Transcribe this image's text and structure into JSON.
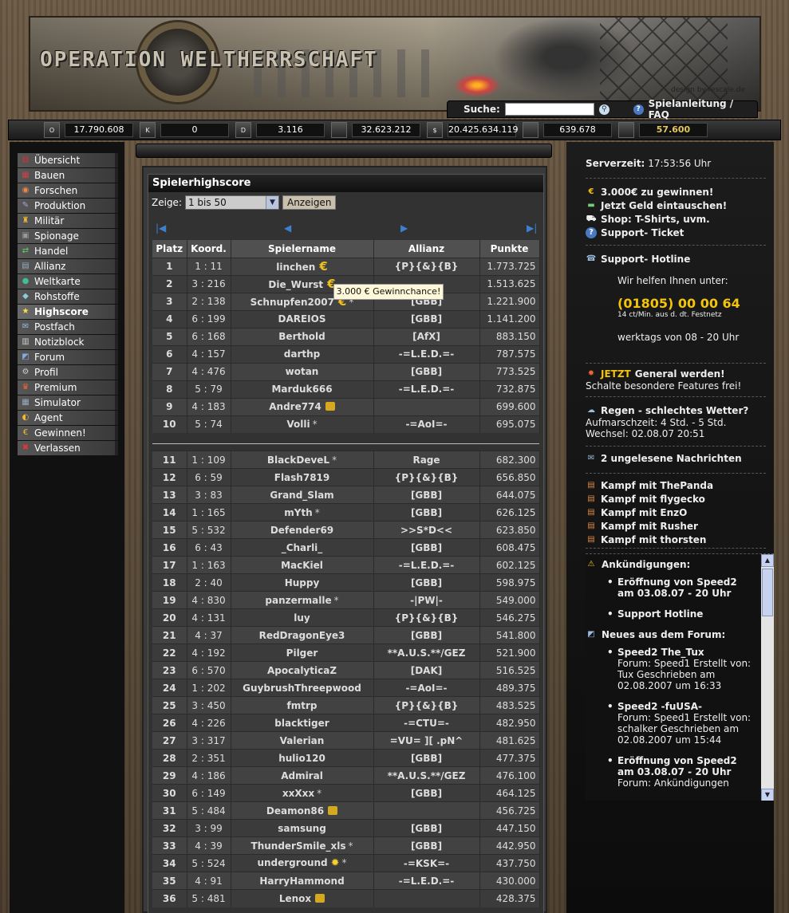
{
  "banner": {
    "logo_text": "OPERATION WELTHERRSCHAFT",
    "credit": "design by rescale.de"
  },
  "search": {
    "label": "Suche:",
    "value": "",
    "help_link": "Spielanleitung / FAQ"
  },
  "resources": [
    {
      "icon": "ore-icon",
      "badge": "O",
      "value": "17.790.608"
    },
    {
      "icon": "crystal-icon",
      "badge": "K",
      "value": "0"
    },
    {
      "icon": "deuterium-icon",
      "badge": "D",
      "value": "3.116"
    },
    {
      "icon": "ammo-icon",
      "badge": "",
      "value": "32.623.212"
    },
    {
      "icon": "money-icon",
      "badge": "$",
      "value": "20.425.634.119"
    },
    {
      "icon": "gold-bar-icon",
      "badge": "",
      "value": "639.678"
    },
    {
      "icon": "rank-icon",
      "badge": "",
      "value": "57.600"
    }
  ],
  "nav": [
    {
      "label": "Übersicht",
      "icon": "overview-icon",
      "glyph": "▤",
      "color": "#c33"
    },
    {
      "label": "Bauen",
      "icon": "build-icon",
      "glyph": "▦",
      "color": "#c44"
    },
    {
      "label": "Forschen",
      "icon": "research-icon",
      "glyph": "◉",
      "color": "#e84"
    },
    {
      "label": "Produktion",
      "icon": "production-icon",
      "glyph": "✎",
      "color": "#9ad"
    },
    {
      "label": "Militär",
      "icon": "military-icon",
      "glyph": "♜",
      "color": "#eb3"
    },
    {
      "label": "Spionage",
      "icon": "spy-icon",
      "glyph": "▣",
      "color": "#999"
    },
    {
      "label": "Handel",
      "icon": "trade-icon",
      "glyph": "⇄",
      "color": "#6c6"
    },
    {
      "label": "Allianz",
      "icon": "alliance-icon",
      "glyph": "▤",
      "color": "#9ab"
    },
    {
      "label": "Weltkarte",
      "icon": "globe-icon",
      "glyph": "●",
      "color": "#4b9"
    },
    {
      "label": "Rohstoffe",
      "icon": "resources-icon",
      "glyph": "◆",
      "color": "#8cd"
    },
    {
      "label": "Highscore",
      "icon": "highscore-icon",
      "glyph": "★",
      "color": "#fd4",
      "active": true
    },
    {
      "label": "Postfach",
      "icon": "mail-icon",
      "glyph": "✉",
      "color": "#9bd"
    },
    {
      "label": "Notizblock",
      "icon": "notepad-icon",
      "glyph": "▥",
      "color": "#ccc"
    },
    {
      "label": "Forum",
      "icon": "forum-icon",
      "glyph": "◩",
      "color": "#8ad"
    },
    {
      "label": "Profil",
      "icon": "profile-gear-icon",
      "glyph": "⚙",
      "color": "#ccc"
    },
    {
      "label": "Premium",
      "icon": "premium-icon",
      "glyph": "♛",
      "color": "#e63"
    },
    {
      "label": "Simulator",
      "icon": "simulator-icon",
      "glyph": "▦",
      "color": "#9ab"
    },
    {
      "label": "Agent",
      "icon": "agent-icon",
      "glyph": "◐",
      "color": "#eb3"
    },
    {
      "label": "Gewinnen!",
      "icon": "euro-icon",
      "glyph": "€",
      "color": "#eb3"
    },
    {
      "label": "Verlassen",
      "icon": "exit-icon",
      "glyph": "✖",
      "color": "#e33"
    }
  ],
  "highscore": {
    "title": "Spielerhighscore",
    "show_label": "Zeige:",
    "select_value": "1 bis 50",
    "submit_label": "Anzeigen",
    "columns": [
      "Platz",
      "Koord.",
      "Spielername",
      "Allianz",
      "Punkte"
    ],
    "tooltip": "3.000 € Gewinnchance!",
    "top_rows": [
      {
        "rank": "1",
        "koord": "1 : 11",
        "name": "linchen",
        "badge": "euro",
        "ally": "{P}{&}{B}",
        "points": "1.773.725"
      },
      {
        "rank": "2",
        "koord": "3 : 216",
        "name": "Die_Wurst",
        "badge": "euro",
        "ally": "",
        "points": "1.513.625"
      },
      {
        "rank": "3",
        "koord": "2 : 138",
        "name": "Schnupfen2007",
        "badge": "euro-star",
        "ally": "[GBB]",
        "points": "1.221.900"
      },
      {
        "rank": "4",
        "koord": "6 : 199",
        "name": "DAREIOS",
        "badge": "",
        "ally": "[GBB]",
        "points": "1.141.200"
      },
      {
        "rank": "5",
        "koord": "6 : 168",
        "name": "Berthold",
        "badge": "",
        "ally": "[AfX]",
        "points": "883.150"
      },
      {
        "rank": "6",
        "koord": "4 : 157",
        "name": "darthp",
        "badge": "",
        "ally": "-=L.E.D.=-",
        "points": "787.575"
      },
      {
        "rank": "7",
        "koord": "4 : 476",
        "name": "wotan",
        "badge": "",
        "ally": "[GBB]",
        "points": "773.525"
      },
      {
        "rank": "8",
        "koord": "5 : 79",
        "name": "Marduk666",
        "badge": "",
        "ally": "-=L.E.D.=-",
        "points": "732.875"
      },
      {
        "rank": "9",
        "koord": "4 : 183",
        "name": "Andre774",
        "badge": "lock",
        "ally": "",
        "points": "699.600"
      },
      {
        "rank": "10",
        "koord": "5 : 74",
        "name": "Volli",
        "badge": "star",
        "ally": "-=AoI=-",
        "points": "695.075"
      }
    ],
    "rows": [
      {
        "rank": "11",
        "koord": "1 : 109",
        "name": "BlackDeveL",
        "badge": "star",
        "ally": "Rage",
        "points": "682.300"
      },
      {
        "rank": "12",
        "koord": "6 : 59",
        "name": "Flash7819",
        "badge": "",
        "ally": "{P}{&}{B}",
        "points": "656.850"
      },
      {
        "rank": "13",
        "koord": "3 : 83",
        "name": "Grand_Slam",
        "badge": "",
        "ally": "[GBB]",
        "points": "644.075"
      },
      {
        "rank": "14",
        "koord": "1 : 165",
        "name": "mYth",
        "badge": "star",
        "ally": "[GBB]",
        "points": "626.125"
      },
      {
        "rank": "15",
        "koord": "5 : 532",
        "name": "Defender69",
        "badge": "",
        "ally": ">>S*D<<",
        "points": "623.850"
      },
      {
        "rank": "16",
        "koord": "6 : 43",
        "name": "_Charli_",
        "badge": "",
        "ally": "[GBB]",
        "points": "608.475"
      },
      {
        "rank": "17",
        "koord": "1 : 163",
        "name": "MacKiel",
        "badge": "",
        "ally": "-=L.E.D.=-",
        "points": "602.125"
      },
      {
        "rank": "18",
        "koord": "2 : 40",
        "name": "Huppy",
        "badge": "",
        "ally": "[GBB]",
        "points": "598.975"
      },
      {
        "rank": "19",
        "koord": "4 : 830",
        "name": "panzermalle",
        "badge": "star",
        "ally": "-|PW|-",
        "points": "549.000"
      },
      {
        "rank": "20",
        "koord": "4 : 131",
        "name": "luy",
        "badge": "",
        "ally": "{P}{&}{B}",
        "points": "546.275"
      },
      {
        "rank": "21",
        "koord": "4 : 37",
        "name": "RedDragonEye3",
        "badge": "",
        "ally": "[GBB]",
        "points": "541.800"
      },
      {
        "rank": "22",
        "koord": "4 : 192",
        "name": "Pilger",
        "badge": "",
        "ally": "**A.U.S.**/GEZ",
        "points": "521.900"
      },
      {
        "rank": "23",
        "koord": "6 : 570",
        "name": "ApocalyticaZ",
        "badge": "",
        "ally": "[DAK]",
        "points": "516.525"
      },
      {
        "rank": "24",
        "koord": "1 : 202",
        "name": "GuybrushThreepwood",
        "badge": "",
        "ally": "-=AoI=-",
        "points": "489.375"
      },
      {
        "rank": "25",
        "koord": "3 : 450",
        "name": "fmtrp",
        "badge": "",
        "ally": "{P}{&}{B}",
        "points": "483.525"
      },
      {
        "rank": "26",
        "koord": "4 : 226",
        "name": "blacktiger",
        "badge": "",
        "ally": "-=CTU=-",
        "points": "482.950"
      },
      {
        "rank": "27",
        "koord": "3 : 317",
        "name": "Valerian",
        "badge": "",
        "ally": "=VU= ][ .pN^",
        "points": "481.625"
      },
      {
        "rank": "28",
        "koord": "2 : 351",
        "name": "hulio120",
        "badge": "",
        "ally": "[GBB]",
        "points": "477.375"
      },
      {
        "rank": "29",
        "koord": "4 : 186",
        "name": "Admiral",
        "badge": "",
        "ally": "**A.U.S.**/GEZ",
        "points": "476.100"
      },
      {
        "rank": "30",
        "koord": "6 : 149",
        "name": "xxXxx",
        "badge": "star",
        "ally": "[GBB]",
        "points": "464.125"
      },
      {
        "rank": "31",
        "koord": "5 : 484",
        "name": "Deamon86",
        "badge": "lock",
        "ally": "",
        "points": "456.725"
      },
      {
        "rank": "32",
        "koord": "3 : 99",
        "name": "samsung",
        "badge": "",
        "ally": "[GBB]",
        "points": "447.150"
      },
      {
        "rank": "33",
        "koord": "4 : 39",
        "name": "ThunderSmile_xls",
        "badge": "star",
        "ally": "[GBB]",
        "points": "442.950"
      },
      {
        "rank": "34",
        "koord": "5 : 524",
        "name": "underground",
        "badge": "sun-star",
        "ally": "-=KSK=-",
        "points": "437.750"
      },
      {
        "rank": "35",
        "koord": "4 : 91",
        "name": "HarryHammond",
        "badge": "",
        "ally": "-=L.E.D.=-",
        "points": "430.000"
      },
      {
        "rank": "36",
        "koord": "5 : 481",
        "name": "Lenox",
        "badge": "lock",
        "ally": "",
        "points": "428.375"
      }
    ]
  },
  "right": {
    "server_time_label": "Serverzeit:",
    "server_time": "17:53:56 Uhr",
    "promo": [
      {
        "icon": "euro-icon",
        "text": "3.000€ zu gewinnen!"
      },
      {
        "icon": "money-icon",
        "text": "Jetzt Geld eintauschen!"
      },
      {
        "icon": "cart-icon",
        "text": "Shop: T-Shirts, uvm."
      },
      {
        "icon": "help-icon",
        "text": "Support- Ticket"
      }
    ],
    "hotline_title": "Support- Hotline",
    "hotline_intro": "Wir helfen Ihnen unter:",
    "hotline_number": "(01805) 00 00 64",
    "hotline_price": "14 ct/Min. aus d. dt. Festnetz",
    "hotline_hours": "werktags von 08 - 20 Uhr",
    "general_highlight": "JETZT",
    "general_text": "General werden!",
    "general_sub": "Schalte besondere Features frei!",
    "weather_title": "Regen - schlechtes Wetter?",
    "weather_line1": "Aufmarschzeit: 4 Std. - 5 Std.",
    "weather_line2": "Wechsel: 02.08.07 20:51",
    "messages": "2 ungelesene Nachrichten",
    "fights": [
      "Kampf mit ThePanda",
      "Kampf mit flygecko",
      "Kampf mit EnzO",
      "Kampf mit Rusher",
      "Kampf mit thorsten"
    ],
    "announcements_title": "Ankündigungen:",
    "announcements": [
      "Eröffnung von Speed2 am 03.08.07 - 20 Uhr",
      "Support Hotline"
    ],
    "forum_title": "Neues aus dem Forum:",
    "forum_posts": [
      {
        "title": "Speed2 The_Tux",
        "meta": "Forum: Speed1 Erstellt von: Tux Geschrieben am 02.08.2007 um 16:33"
      },
      {
        "title": "Speed2 -fuUSA-",
        "meta": "Forum: Speed1 Erstellt von: schalker Geschrieben am 02.08.2007 um 15:44"
      },
      {
        "title": "Eröffnung von Speed2 am 03.08.07 - 20 Uhr",
        "meta": "Forum: Ankündigungen"
      }
    ]
  }
}
